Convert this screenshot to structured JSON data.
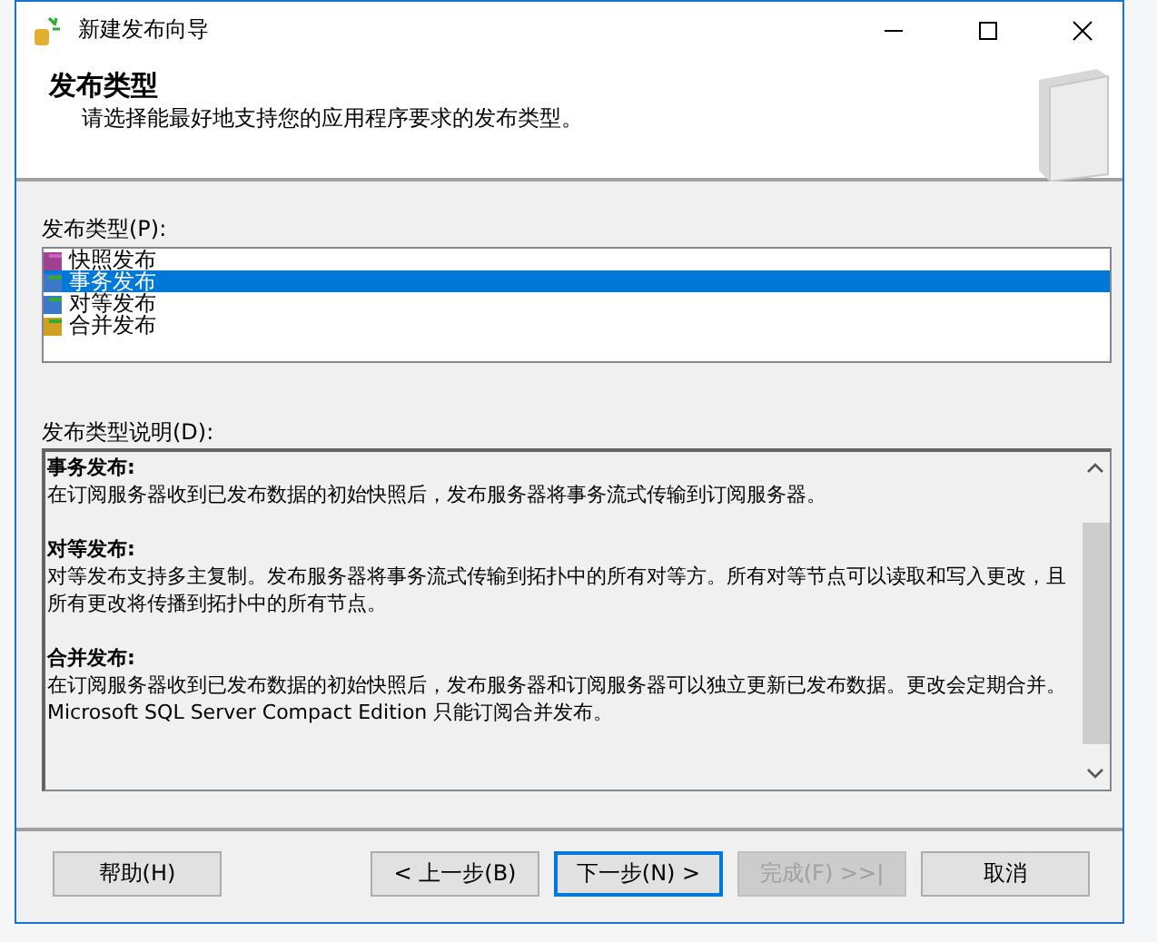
{
  "window": {
    "title": "新建发布向导"
  },
  "header": {
    "title": "发布类型",
    "subtitle": "请选择能最好地支持您的应用程序要求的发布类型。"
  },
  "types_label": "发布类型(P):",
  "types": [
    {
      "label": "快照发布",
      "kind": "snapshot",
      "selected": false
    },
    {
      "label": "事务发布",
      "kind": "transactional",
      "selected": true
    },
    {
      "label": "对等发布",
      "kind": "transactional",
      "selected": false
    },
    {
      "label": "合并发布",
      "kind": "merge",
      "selected": false
    }
  ],
  "description_label": "发布类型说明(D):",
  "description": [
    {
      "title": "事务发布:",
      "text": "在订阅服务器收到已发布数据的初始快照后，发布服务器将事务流式传输到订阅服务器。"
    },
    {
      "title": "对等发布:",
      "text": "对等发布支持多主复制。发布服务器将事务流式传输到拓扑中的所有对等方。所有对等节点可以读取和写入更改，且所有更改将传播到拓扑中的所有节点。"
    },
    {
      "title": "合并发布:",
      "text": "在订阅服务器收到已发布数据的初始快照后，发布服务器和订阅服务器可以独立更新已发布数据。更改会定期合并。Microsoft SQL Server Compact Edition 只能订阅合并发布。"
    }
  ],
  "buttons": [
    {
      "label": "帮助(H)",
      "disabled": false,
      "default": false
    },
    {
      "label": "< 上一步(B)",
      "disabled": false,
      "default": false
    },
    {
      "label": "下一步(N) >",
      "disabled": false,
      "default": true
    },
    {
      "label": "完成(F) >>|",
      "disabled": true,
      "default": false
    },
    {
      "label": "取消",
      "disabled": false,
      "default": false
    }
  ]
}
